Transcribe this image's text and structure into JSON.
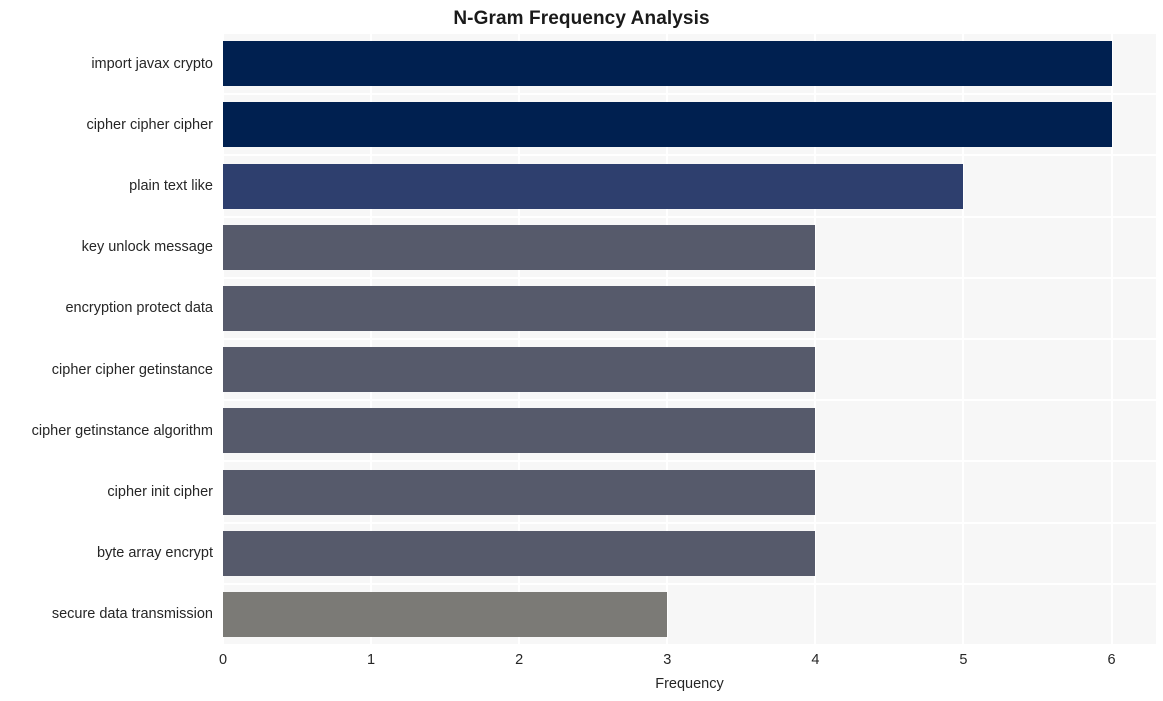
{
  "chart_data": {
    "type": "bar",
    "orientation": "horizontal",
    "title": "N-Gram Frequency Analysis",
    "xlabel": "Frequency",
    "ylabel": "",
    "xlim": [
      0,
      6.3
    ],
    "xticks": [
      0,
      1,
      2,
      3,
      4,
      5,
      6
    ],
    "xticklabels": [
      "0",
      "1",
      "2",
      "3",
      "4",
      "5",
      "6"
    ],
    "grid": true,
    "legend": "none",
    "categories": [
      "import javax crypto",
      "cipher cipher cipher",
      "plain text like",
      "key unlock message",
      "encryption protect data",
      "cipher cipher getinstance",
      "cipher getinstance algorithm",
      "cipher init cipher",
      "byte array encrypt",
      "secure data transmission"
    ],
    "values": [
      6,
      6,
      5,
      4,
      4,
      4,
      4,
      4,
      4,
      3
    ],
    "bar_colors": [
      "#002050",
      "#002050",
      "#2e3f6e",
      "#565a6b",
      "#565a6b",
      "#565a6b",
      "#565a6b",
      "#565a6b",
      "#565a6b",
      "#7b7a76"
    ],
    "plot_background": "#f7f7f7",
    "grid_color": "#ffffff",
    "figure_background": "#ffffff"
  }
}
